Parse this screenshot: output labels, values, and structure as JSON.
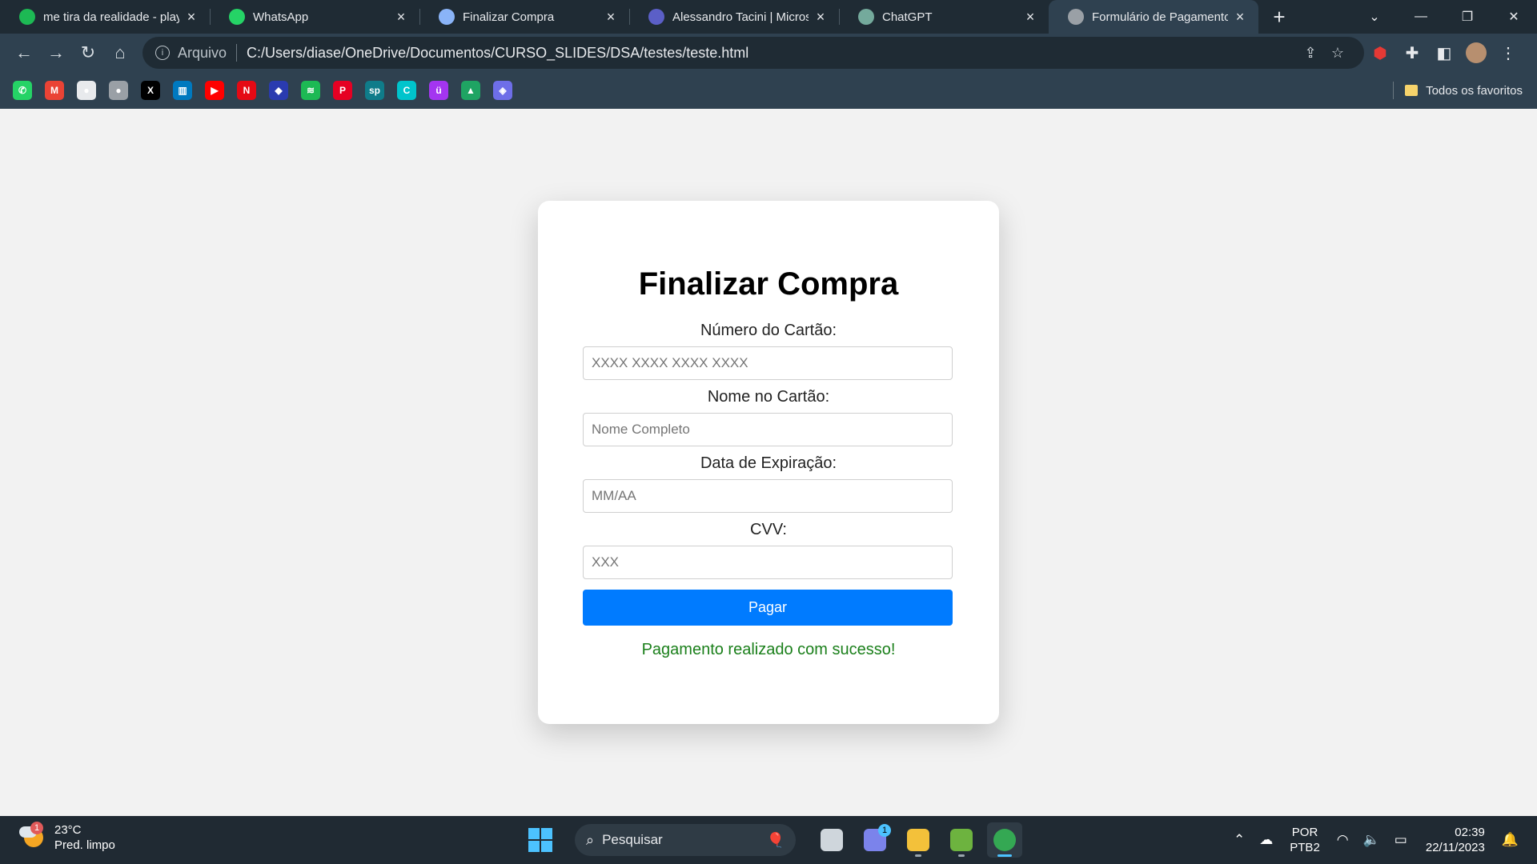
{
  "browser": {
    "tabs": [
      {
        "title": "me tira da realidade - playlist",
        "icon": "spotify-icon",
        "color": "#1db954",
        "active": false
      },
      {
        "title": "WhatsApp",
        "icon": "whatsapp-icon",
        "color": "#25d366",
        "active": false
      },
      {
        "title": "Finalizar Compra",
        "icon": "globe-icon",
        "color": "#8ab4f8",
        "active": false
      },
      {
        "title": "Alessandro Tacini | Microsoft Teams",
        "icon": "teams-icon",
        "color": "#5b5fc7",
        "active": false
      },
      {
        "title": "ChatGPT",
        "icon": "chatgpt-icon",
        "color": "#74aa9c",
        "active": false
      },
      {
        "title": "Formulário de Pagamento",
        "icon": "globe-icon",
        "color": "#9aa0a6",
        "active": true
      }
    ],
    "address": {
      "scheme": "Arquivo",
      "url": "C:/Users/diase/OneDrive/Documentos/CURSO_SLIDES/DSA/testes/teste.html"
    },
    "bookmarks": [
      {
        "icon": "whatsapp-icon",
        "color": "#25d366",
        "glyph": "✆"
      },
      {
        "icon": "gmail-icon",
        "color": "#ea4335",
        "glyph": "M"
      },
      {
        "icon": "github-icon",
        "color": "#e8eaed",
        "glyph": "●"
      },
      {
        "icon": "apple-icon",
        "color": "#9aa0a6",
        "glyph": "●"
      },
      {
        "icon": "x-icon",
        "color": "#000000",
        "glyph": "X"
      },
      {
        "icon": "trello-icon",
        "color": "#0079bf",
        "glyph": "▥"
      },
      {
        "icon": "youtube-icon",
        "color": "#ff0000",
        "glyph": "▶"
      },
      {
        "icon": "netflix-icon",
        "color": "#e50914",
        "glyph": "N"
      },
      {
        "icon": "bookmark-blue-icon",
        "color": "#2a3bb0",
        "glyph": "◆"
      },
      {
        "icon": "spotify-icon",
        "color": "#1db954",
        "glyph": "≋"
      },
      {
        "icon": "pinterest-icon",
        "color": "#e60023",
        "glyph": "P"
      },
      {
        "icon": "sp-icon",
        "color": "#0f7c8a",
        "glyph": "sp"
      },
      {
        "icon": "canva-icon",
        "color": "#00c4cc",
        "glyph": "C"
      },
      {
        "icon": "udemy-icon",
        "color": "#a435f0",
        "glyph": "ü"
      },
      {
        "icon": "google-drive-icon",
        "color": "#1fa463",
        "glyph": "▲"
      },
      {
        "icon": "copilot-icon",
        "color": "#6e6ee8",
        "glyph": "◈"
      }
    ],
    "bookmarks_folder": "Todos os favoritos"
  },
  "page": {
    "title": "Finalizar Compra",
    "card_number": {
      "label": "Número do Cartão:",
      "placeholder": "XXXX XXXX XXXX XXXX"
    },
    "card_name": {
      "label": "Nome no Cartão:",
      "placeholder": "Nome Completo"
    },
    "expiry": {
      "label": "Data de Expiração:",
      "placeholder": "MM/AA"
    },
    "cvv": {
      "label": "CVV:",
      "placeholder": "XXX"
    },
    "pay_button": "Pagar",
    "success_message": "Pagamento realizado com sucesso!",
    "colors": {
      "button": "#007bff",
      "success": "#1a7f1a"
    }
  },
  "taskbar": {
    "weather": {
      "temp": "23°C",
      "desc": "Pred. limpo",
      "badge": "1"
    },
    "search_placeholder": "Pesquisar",
    "apps": [
      {
        "name": "task-view-icon",
        "active": false,
        "badge": ""
      },
      {
        "name": "teams-chat-icon",
        "active": false,
        "badge": "1"
      },
      {
        "name": "file-explorer-icon",
        "active": false,
        "badge": ""
      },
      {
        "name": "spring-icon",
        "active": false,
        "badge": ""
      },
      {
        "name": "chrome-icon",
        "active": true,
        "badge": ""
      }
    ],
    "lang_top": "POR",
    "lang_bottom": "PTB2",
    "time": "02:39",
    "date": "22/11/2023"
  }
}
